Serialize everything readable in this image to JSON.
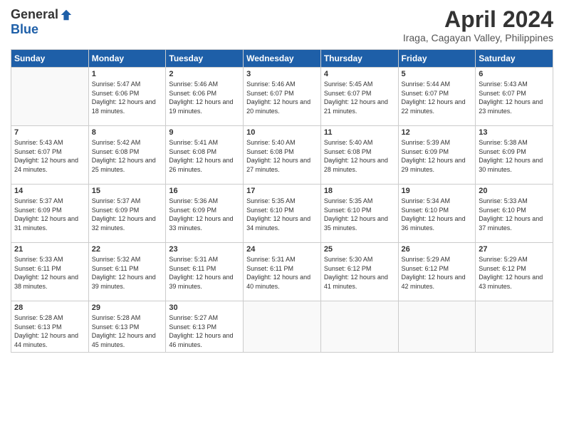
{
  "logo": {
    "general": "General",
    "blue": "Blue"
  },
  "title": "April 2024",
  "location": "Iraga, Cagayan Valley, Philippines",
  "days_of_week": [
    "Sunday",
    "Monday",
    "Tuesday",
    "Wednesday",
    "Thursday",
    "Friday",
    "Saturday"
  ],
  "weeks": [
    [
      {
        "day": "",
        "sunrise": "",
        "sunset": "",
        "daylight": ""
      },
      {
        "day": "1",
        "sunrise": "Sunrise: 5:47 AM",
        "sunset": "Sunset: 6:06 PM",
        "daylight": "Daylight: 12 hours and 18 minutes."
      },
      {
        "day": "2",
        "sunrise": "Sunrise: 5:46 AM",
        "sunset": "Sunset: 6:06 PM",
        "daylight": "Daylight: 12 hours and 19 minutes."
      },
      {
        "day": "3",
        "sunrise": "Sunrise: 5:46 AM",
        "sunset": "Sunset: 6:07 PM",
        "daylight": "Daylight: 12 hours and 20 minutes."
      },
      {
        "day": "4",
        "sunrise": "Sunrise: 5:45 AM",
        "sunset": "Sunset: 6:07 PM",
        "daylight": "Daylight: 12 hours and 21 minutes."
      },
      {
        "day": "5",
        "sunrise": "Sunrise: 5:44 AM",
        "sunset": "Sunset: 6:07 PM",
        "daylight": "Daylight: 12 hours and 22 minutes."
      },
      {
        "day": "6",
        "sunrise": "Sunrise: 5:43 AM",
        "sunset": "Sunset: 6:07 PM",
        "daylight": "Daylight: 12 hours and 23 minutes."
      }
    ],
    [
      {
        "day": "7",
        "sunrise": "Sunrise: 5:43 AM",
        "sunset": "Sunset: 6:07 PM",
        "daylight": "Daylight: 12 hours and 24 minutes."
      },
      {
        "day": "8",
        "sunrise": "Sunrise: 5:42 AM",
        "sunset": "Sunset: 6:08 PM",
        "daylight": "Daylight: 12 hours and 25 minutes."
      },
      {
        "day": "9",
        "sunrise": "Sunrise: 5:41 AM",
        "sunset": "Sunset: 6:08 PM",
        "daylight": "Daylight: 12 hours and 26 minutes."
      },
      {
        "day": "10",
        "sunrise": "Sunrise: 5:40 AM",
        "sunset": "Sunset: 6:08 PM",
        "daylight": "Daylight: 12 hours and 27 minutes."
      },
      {
        "day": "11",
        "sunrise": "Sunrise: 5:40 AM",
        "sunset": "Sunset: 6:08 PM",
        "daylight": "Daylight: 12 hours and 28 minutes."
      },
      {
        "day": "12",
        "sunrise": "Sunrise: 5:39 AM",
        "sunset": "Sunset: 6:09 PM",
        "daylight": "Daylight: 12 hours and 29 minutes."
      },
      {
        "day": "13",
        "sunrise": "Sunrise: 5:38 AM",
        "sunset": "Sunset: 6:09 PM",
        "daylight": "Daylight: 12 hours and 30 minutes."
      }
    ],
    [
      {
        "day": "14",
        "sunrise": "Sunrise: 5:37 AM",
        "sunset": "Sunset: 6:09 PM",
        "daylight": "Daylight: 12 hours and 31 minutes."
      },
      {
        "day": "15",
        "sunrise": "Sunrise: 5:37 AM",
        "sunset": "Sunset: 6:09 PM",
        "daylight": "Daylight: 12 hours and 32 minutes."
      },
      {
        "day": "16",
        "sunrise": "Sunrise: 5:36 AM",
        "sunset": "Sunset: 6:09 PM",
        "daylight": "Daylight: 12 hours and 33 minutes."
      },
      {
        "day": "17",
        "sunrise": "Sunrise: 5:35 AM",
        "sunset": "Sunset: 6:10 PM",
        "daylight": "Daylight: 12 hours and 34 minutes."
      },
      {
        "day": "18",
        "sunrise": "Sunrise: 5:35 AM",
        "sunset": "Sunset: 6:10 PM",
        "daylight": "Daylight: 12 hours and 35 minutes."
      },
      {
        "day": "19",
        "sunrise": "Sunrise: 5:34 AM",
        "sunset": "Sunset: 6:10 PM",
        "daylight": "Daylight: 12 hours and 36 minutes."
      },
      {
        "day": "20",
        "sunrise": "Sunrise: 5:33 AM",
        "sunset": "Sunset: 6:10 PM",
        "daylight": "Daylight: 12 hours and 37 minutes."
      }
    ],
    [
      {
        "day": "21",
        "sunrise": "Sunrise: 5:33 AM",
        "sunset": "Sunset: 6:11 PM",
        "daylight": "Daylight: 12 hours and 38 minutes."
      },
      {
        "day": "22",
        "sunrise": "Sunrise: 5:32 AM",
        "sunset": "Sunset: 6:11 PM",
        "daylight": "Daylight: 12 hours and 39 minutes."
      },
      {
        "day": "23",
        "sunrise": "Sunrise: 5:31 AM",
        "sunset": "Sunset: 6:11 PM",
        "daylight": "Daylight: 12 hours and 39 minutes."
      },
      {
        "day": "24",
        "sunrise": "Sunrise: 5:31 AM",
        "sunset": "Sunset: 6:11 PM",
        "daylight": "Daylight: 12 hours and 40 minutes."
      },
      {
        "day": "25",
        "sunrise": "Sunrise: 5:30 AM",
        "sunset": "Sunset: 6:12 PM",
        "daylight": "Daylight: 12 hours and 41 minutes."
      },
      {
        "day": "26",
        "sunrise": "Sunrise: 5:29 AM",
        "sunset": "Sunset: 6:12 PM",
        "daylight": "Daylight: 12 hours and 42 minutes."
      },
      {
        "day": "27",
        "sunrise": "Sunrise: 5:29 AM",
        "sunset": "Sunset: 6:12 PM",
        "daylight": "Daylight: 12 hours and 43 minutes."
      }
    ],
    [
      {
        "day": "28",
        "sunrise": "Sunrise: 5:28 AM",
        "sunset": "Sunset: 6:13 PM",
        "daylight": "Daylight: 12 hours and 44 minutes."
      },
      {
        "day": "29",
        "sunrise": "Sunrise: 5:28 AM",
        "sunset": "Sunset: 6:13 PM",
        "daylight": "Daylight: 12 hours and 45 minutes."
      },
      {
        "day": "30",
        "sunrise": "Sunrise: 5:27 AM",
        "sunset": "Sunset: 6:13 PM",
        "daylight": "Daylight: 12 hours and 46 minutes."
      },
      {
        "day": "",
        "sunrise": "",
        "sunset": "",
        "daylight": ""
      },
      {
        "day": "",
        "sunrise": "",
        "sunset": "",
        "daylight": ""
      },
      {
        "day": "",
        "sunrise": "",
        "sunset": "",
        "daylight": ""
      },
      {
        "day": "",
        "sunrise": "",
        "sunset": "",
        "daylight": ""
      }
    ]
  ]
}
